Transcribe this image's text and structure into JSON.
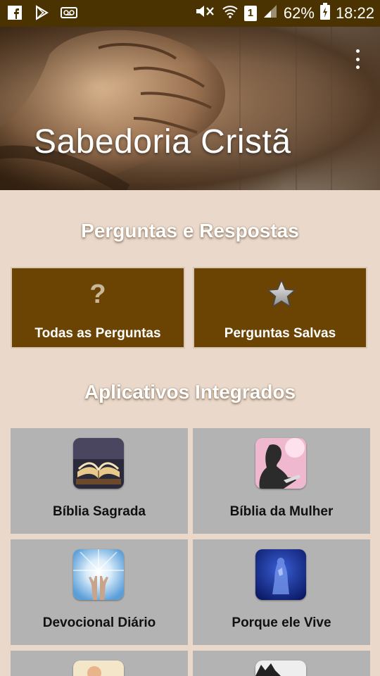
{
  "status_bar": {
    "left_icons": [
      "facebook-icon",
      "play-store-icon",
      "voicemail-icon"
    ],
    "sim": "1",
    "battery": "62%",
    "time": "18:22"
  },
  "header": {
    "title": "Sabedoria Cristã",
    "menu_icon": "overflow-menu-icon"
  },
  "qa_section": {
    "title": "Perguntas e Respostas",
    "tiles": [
      {
        "label": "Todas as Perguntas",
        "icon": "?"
      },
      {
        "label": "Perguntas Salvas",
        "icon": "star-icon"
      }
    ]
  },
  "apps_section": {
    "title": "Aplicativos Integrados",
    "tiles": [
      {
        "label": "Bíblia Sagrada",
        "icon": "open-book-icon"
      },
      {
        "label": "Bíblia da Mulher",
        "icon": "woman-reading-icon"
      },
      {
        "label": "Devocional Diário",
        "icon": "raised-hands-icon"
      },
      {
        "label": "Porque ele Vive",
        "icon": "praying-figure-icon"
      }
    ]
  },
  "colors": {
    "status_bar": "#4a3300",
    "background": "#ead9cb",
    "brown_tile": "#6b4404",
    "grey_tile": "#b3b3b3"
  }
}
